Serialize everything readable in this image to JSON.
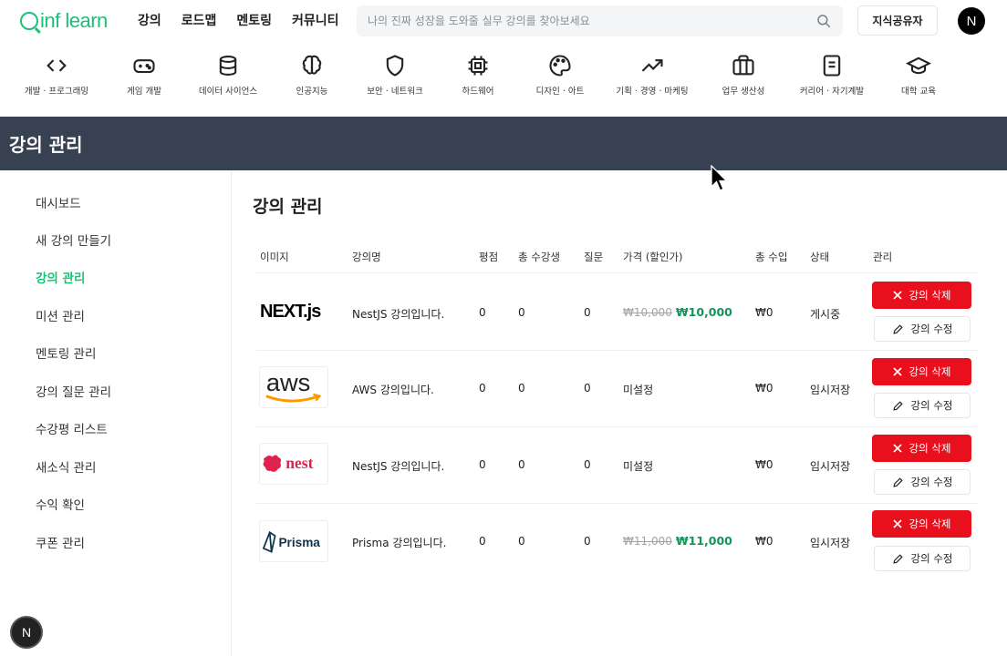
{
  "header": {
    "logo_text": "inf learn",
    "nav": [
      "강의",
      "로드맵",
      "멘토링",
      "커뮤니티"
    ],
    "search_placeholder": "나의 진짜 성장을 도와줄 실무 강의를 찾아보세요",
    "share_button": "지식공유자",
    "avatar_letter": "N"
  },
  "categories": [
    {
      "label": "개발 · 프로그래밍",
      "icon": "code-icon"
    },
    {
      "label": "게임 개발",
      "icon": "gamepad-icon"
    },
    {
      "label": "데이터 사이언스",
      "icon": "database-icon"
    },
    {
      "label": "인공지능",
      "icon": "brain-icon"
    },
    {
      "label": "보안 · 네트워크",
      "icon": "shield-icon"
    },
    {
      "label": "하드웨어",
      "icon": "chip-icon"
    },
    {
      "label": "디자인 · 아트",
      "icon": "palette-icon"
    },
    {
      "label": "기획 · 경영 · 마케팅",
      "icon": "trend-icon"
    },
    {
      "label": "업무 생산성",
      "icon": "briefcase-icon"
    },
    {
      "label": "커리어 · 자기계발",
      "icon": "document-icon"
    },
    {
      "label": "대학 교육",
      "icon": "graduation-cap-icon"
    }
  ],
  "banner_title": "강의 관리",
  "sidebar": {
    "items": [
      {
        "label": "대시보드",
        "active": false
      },
      {
        "label": "새 강의 만들기",
        "active": false
      },
      {
        "label": "강의 관리",
        "active": true
      },
      {
        "label": "미션 관리",
        "active": false
      },
      {
        "label": "멘토링 관리",
        "active": false
      },
      {
        "label": "강의 질문 관리",
        "active": false
      },
      {
        "label": "수강평 리스트",
        "active": false
      },
      {
        "label": "새소식 관리",
        "active": false
      },
      {
        "label": "수익 확인",
        "active": false
      },
      {
        "label": "쿠폰 관리",
        "active": false
      }
    ]
  },
  "main": {
    "title": "강의 관리",
    "columns": [
      "이미지",
      "강의명",
      "평점",
      "총 수강생",
      "질문",
      "가격 (할인가)",
      "총 수입",
      "상태",
      "관리"
    ],
    "delete_label": "강의 삭제",
    "edit_label": "강의 수정",
    "rows": [
      {
        "logo": "nextjs-logo",
        "logo_text": "NEXT.js",
        "name": "NestJS 강의입니다.",
        "rating": "0",
        "students": "0",
        "questions": "0",
        "price_original": "₩10,000",
        "price_discount": "₩10,000",
        "price_unset": "",
        "revenue": "₩0",
        "status": "게시중"
      },
      {
        "logo": "aws-logo",
        "logo_text": "aws",
        "name": "AWS 강의입니다.",
        "rating": "0",
        "students": "0",
        "questions": "0",
        "price_original": "",
        "price_discount": "",
        "price_unset": "미설정",
        "revenue": "₩0",
        "status": "임시저장"
      },
      {
        "logo": "nest-logo",
        "logo_text": "nest",
        "name": "NestJS 강의입니다.",
        "rating": "0",
        "students": "0",
        "questions": "0",
        "price_original": "",
        "price_discount": "",
        "price_unset": "미설정",
        "revenue": "₩0",
        "status": "임시저장"
      },
      {
        "logo": "prisma-logo",
        "logo_text": "Prisma",
        "name": "Prisma 강의입니다.",
        "rating": "0",
        "students": "0",
        "questions": "0",
        "price_original": "₩11,000",
        "price_discount": "₩11,000",
        "price_unset": "",
        "revenue": "₩0",
        "status": "임시저장"
      }
    ]
  },
  "bottom_avatar_letter": "N",
  "colors": {
    "brand": "#1dc078",
    "banner": "#374151",
    "delete": "#e8101d",
    "discount": "#13955a"
  }
}
